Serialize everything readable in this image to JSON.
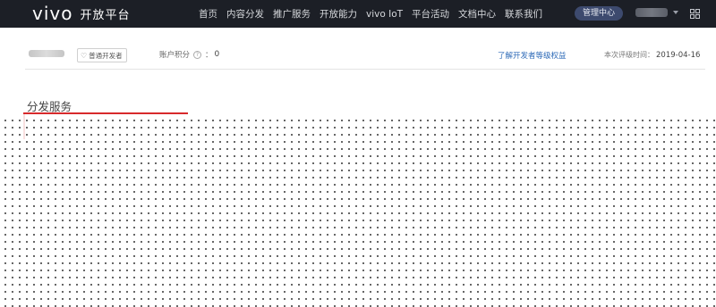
{
  "header": {
    "logo_mark": "vivo",
    "logo_text": "开放平台",
    "nav": [
      {
        "label": "首页"
      },
      {
        "label": "内容分发"
      },
      {
        "label": "推广服务"
      },
      {
        "label": "开放能力"
      },
      {
        "label": "vivo IoT"
      },
      {
        "label": "平台活动"
      },
      {
        "label": "文档中心"
      },
      {
        "label": "联系我们"
      }
    ],
    "manage_button": "管理中心",
    "icons": {
      "user_caret": "chevron-down-icon",
      "apps": "grid-icon"
    }
  },
  "info": {
    "dev_badge": "普通开发者",
    "dev_badge_icon": "badge-icon",
    "points_label": "账户积分",
    "points_separator": "：",
    "points_value": "0",
    "rights_link": "了解开发者等级权益",
    "eval_label": "本次评级时间：",
    "eval_date": "2019-04-16"
  },
  "section": {
    "title": "分发服务"
  },
  "colors": {
    "topbar": "#1c1f26",
    "link": "#2d6ab7",
    "highlight": "#d7292b"
  }
}
